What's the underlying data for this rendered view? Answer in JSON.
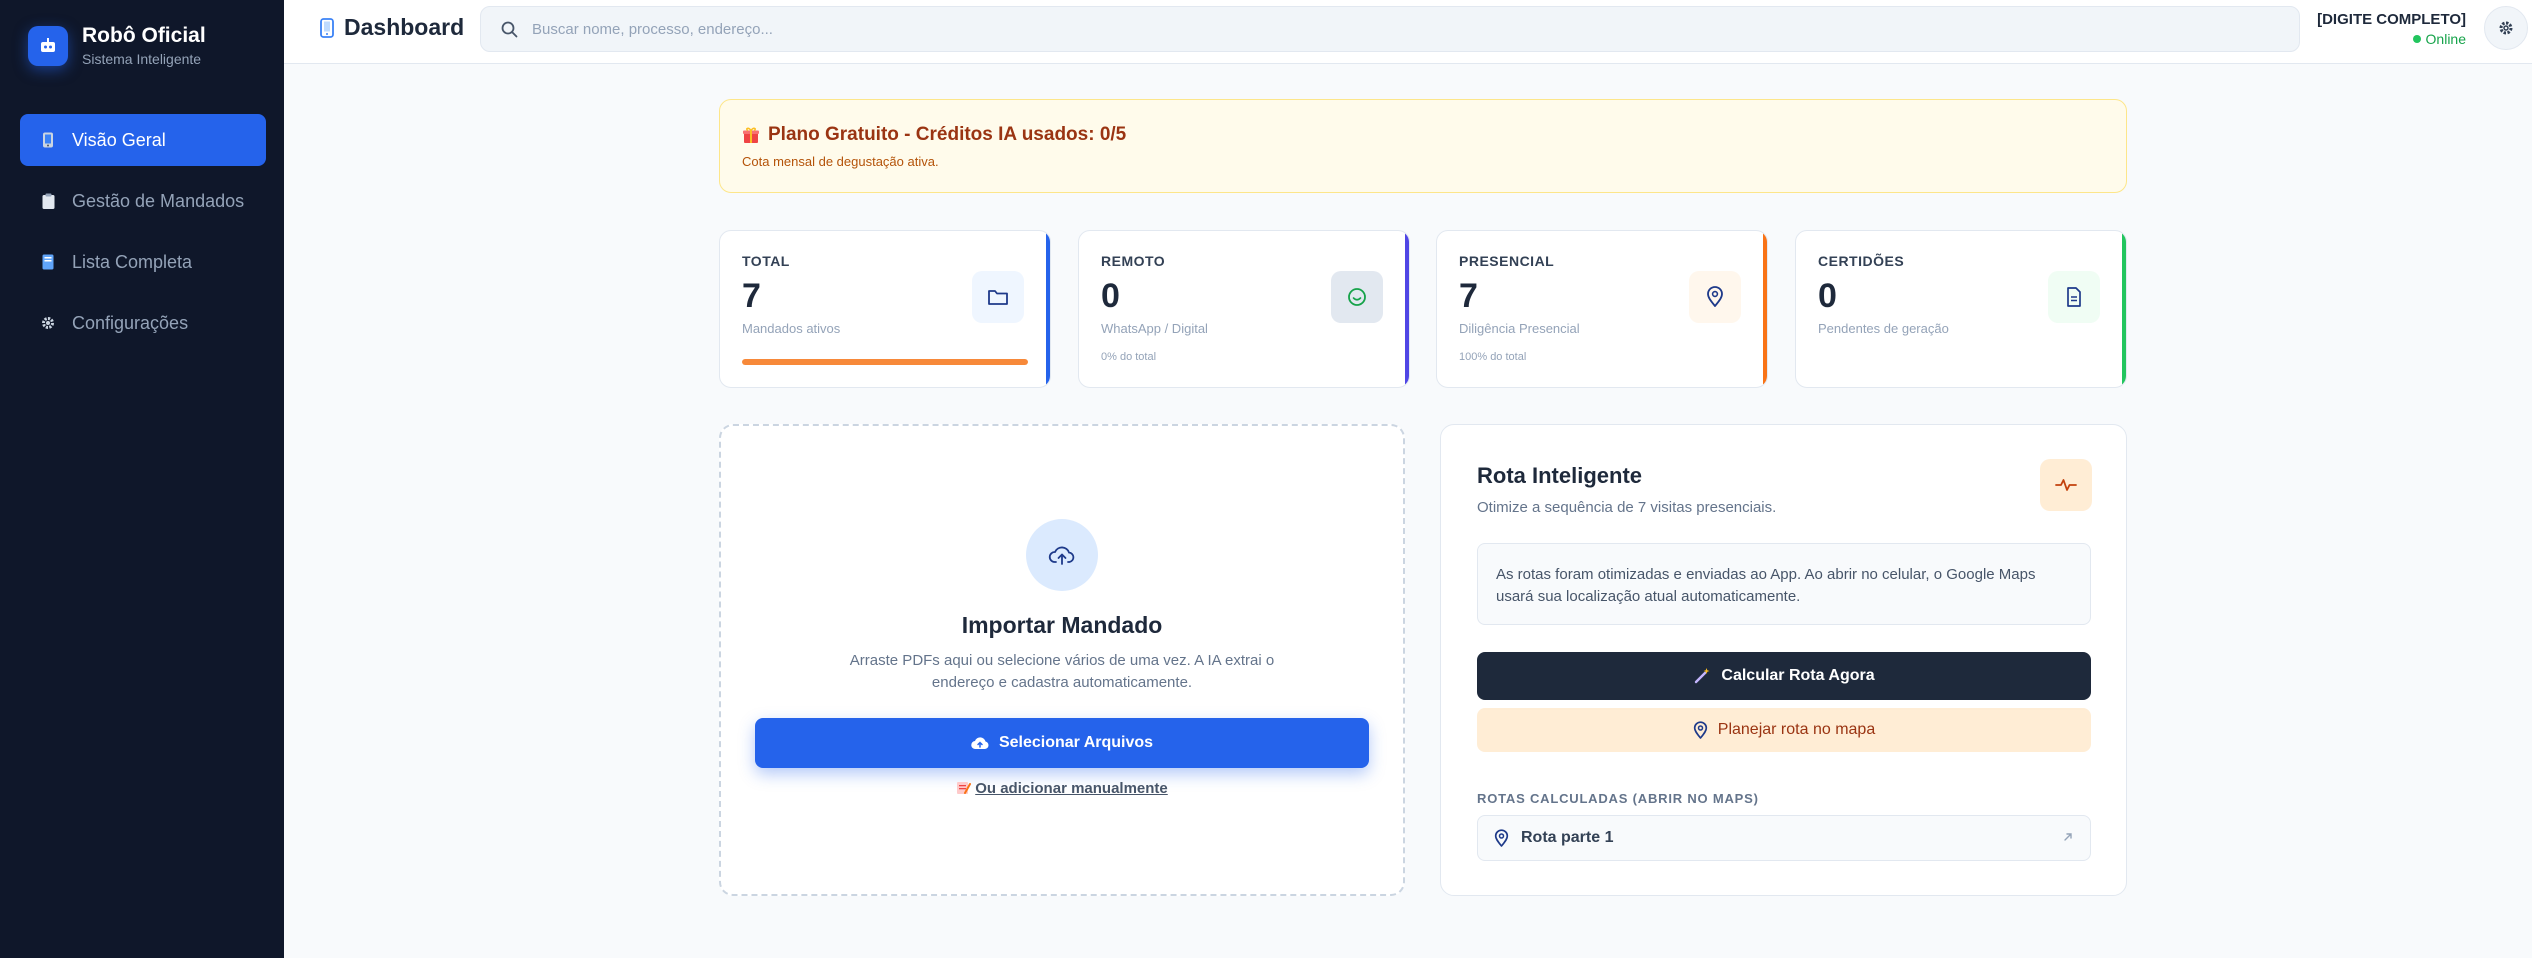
{
  "sidebar": {
    "brand_title": "Robô Oficial",
    "brand_subtitle": "Sistema Inteligente",
    "items": [
      {
        "label": "Visão Geral",
        "icon": "mobile-icon",
        "active": true
      },
      {
        "label": "Gestão de Mandados",
        "icon": "clipboard-icon",
        "active": false
      },
      {
        "label": "Lista Completa",
        "icon": "book-icon",
        "active": false
      },
      {
        "label": "Configurações",
        "icon": "gear-icon",
        "active": false
      }
    ]
  },
  "header": {
    "title": "Dashboard",
    "search_placeholder": "Buscar nome, processo, endereço...",
    "user_name": "[DIGITE COMPLETO]",
    "user_status": "Online"
  },
  "banner": {
    "icon": "gift-icon",
    "title": "Plano Gratuito - Créditos IA usados: 0/5",
    "subtitle": "Cota mensal de degustação ativa."
  },
  "stats": [
    {
      "label": "TOTAL",
      "value": "7",
      "desc": "Mandados ativos",
      "progress": 1.0,
      "accent": "#2563eb",
      "icon": "folder-icon"
    },
    {
      "label": "REMOTO",
      "value": "0",
      "desc": "WhatsApp / Digital",
      "pct": "0% do total",
      "accent": "#4f46e5",
      "icon": "chat-icon"
    },
    {
      "label": "PRESENCIAL",
      "value": "7",
      "desc": "Diligência Presencial",
      "pct": "100% do total",
      "accent": "#f97316",
      "icon": "map-pin-icon"
    },
    {
      "label": "CERTIDÕES",
      "value": "0",
      "desc": "Pendentes de geração",
      "accent": "#22c55e",
      "icon": "document-icon"
    }
  ],
  "import": {
    "title": "Importar Mandado",
    "description": "Arraste PDFs aqui ou selecione vários de uma vez. A IA extrai o endereço e cadastra automaticamente.",
    "select_button": "Selecionar Arquivos",
    "manual_link": "Ou adicionar manualmente"
  },
  "route": {
    "title": "Rota Inteligente",
    "subtitle": "Otimize a sequência de 7 visitas presenciais.",
    "info": "As rotas foram otimizadas e enviadas ao App. Ao abrir no celular, o Google Maps usará sua localização atual automaticamente.",
    "calc_button": "Calcular Rota Agora",
    "plan_button": "Planejar rota no mapa",
    "routes_header": "ROTAS CALCULADAS (ABRIR NO MAPS)",
    "routes": [
      {
        "label": "Rota parte 1"
      }
    ]
  },
  "colors": {
    "sidebar_bg": "#0f172a",
    "primary": "#2563eb",
    "dark_button": "#1e293b",
    "orange_soft": "#ffedd5",
    "banner_bg": "#fffbeb"
  }
}
